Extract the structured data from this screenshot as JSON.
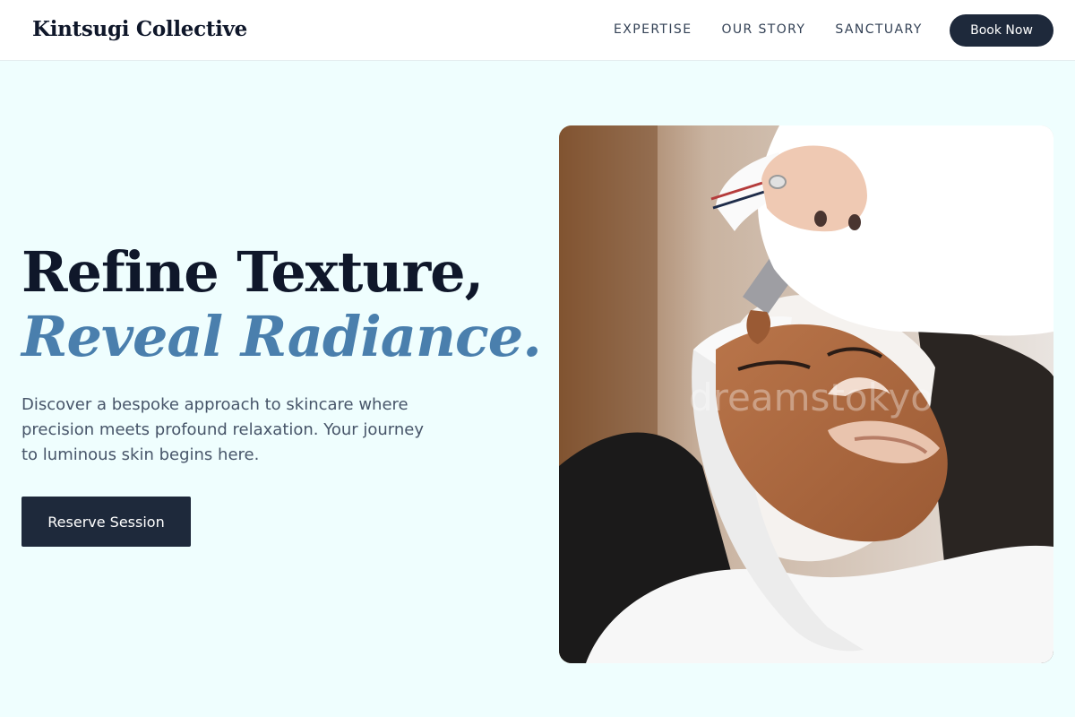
{
  "header": {
    "brand": "Kintsugi Collective",
    "nav": [
      {
        "label": "EXPERTISE"
      },
      {
        "label": "OUR STORY"
      },
      {
        "label": "SANCTUARY"
      }
    ],
    "cta_label": "Book Now"
  },
  "hero": {
    "headline_line1": "Refine Texture,",
    "headline_line2": "Reveal Radiance.",
    "lead": "Discover a bespoke approach to skincare where precision meets profound relaxation. Your journey to luminous skin begins here.",
    "cta_label": "Reserve Session",
    "image_watermark": "dreamstokyo"
  },
  "colors": {
    "background": "#effefe",
    "primary": "#1e293b",
    "accent": "#4a7fad"
  }
}
